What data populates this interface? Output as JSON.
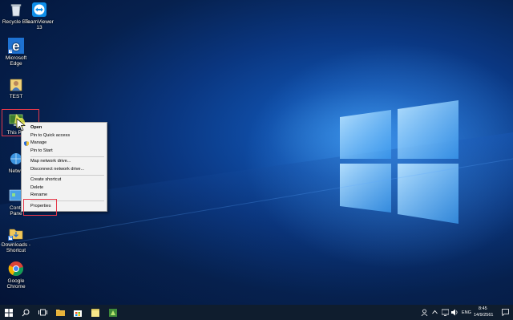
{
  "desktop": {
    "icons": [
      {
        "name": "recycle-bin",
        "label": "Recycle Bin"
      },
      {
        "name": "teamviewer",
        "label": "TeamViewer\n13"
      },
      {
        "name": "microsoft-edge",
        "label": "Microsoft\nEdge"
      },
      {
        "name": "test-user-folder",
        "label": "TEST"
      },
      {
        "name": "this-pc",
        "label": "This PC"
      },
      {
        "name": "network",
        "label": "Netwo"
      },
      {
        "name": "control-panel",
        "label": "Contr\nPane"
      },
      {
        "name": "downloads-shortcut",
        "label": "Downloads -\nShortcut"
      },
      {
        "name": "google-chrome",
        "label": "Google\nChrome"
      }
    ]
  },
  "context_menu": {
    "items": [
      {
        "label": "Open",
        "bold": true
      },
      {
        "label": "Pin to Quick access"
      },
      {
        "label": "Manage",
        "icon": "shield-icon"
      },
      {
        "label": "Pin to Start"
      },
      {
        "label": "Map network drive..."
      },
      {
        "label": "Disconnect network drive..."
      },
      {
        "label": "Create shortcut"
      },
      {
        "label": "Delete"
      },
      {
        "label": "Rename"
      },
      {
        "label": "Properties"
      }
    ]
  },
  "taskbar": {
    "buttons": [
      "start-icon",
      "search-icon",
      "task-view-icon",
      "file-explorer-icon",
      "store-icon",
      "sticky-notes-icon",
      "app-icon"
    ],
    "tray": {
      "language": "ENG",
      "time": "8:45",
      "date": "14/9/2561"
    }
  },
  "colors": {
    "accent": "#e5394a",
    "taskbar": "#0f1d2e",
    "menu_bg": "#f2f2f2"
  }
}
